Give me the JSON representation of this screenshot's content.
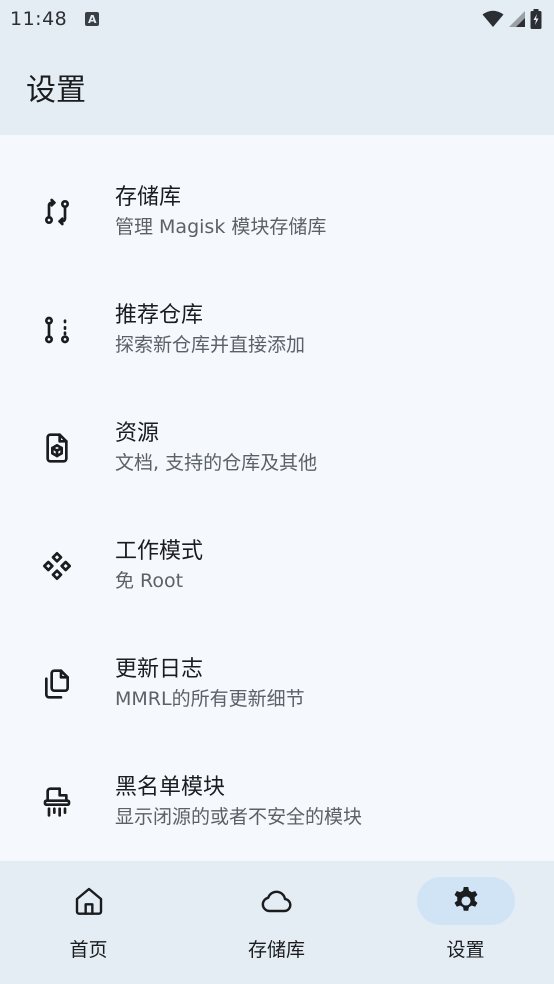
{
  "status_bar": {
    "time": "11:48",
    "notification_icon": "A",
    "icons": [
      "wifi-icon",
      "signal-icon",
      "battery-charging-icon"
    ]
  },
  "header": {
    "title": "设置"
  },
  "settings": [
    {
      "title": "存储库",
      "subtitle": "管理 Magisk 模块存储库",
      "icon": "git-compare-icon"
    },
    {
      "title": "推荐仓库",
      "subtitle": "探索新仓库并直接添加",
      "icon": "git-pull-request-draft-icon"
    },
    {
      "title": "资源",
      "subtitle": "文档, 支持的仓库及其他",
      "icon": "file-box-icon"
    },
    {
      "title": "工作模式",
      "subtitle": "免 Root",
      "icon": "components-icon"
    },
    {
      "title": "更新日志",
      "subtitle": "MMRL的所有更新细节",
      "icon": "files-icon"
    },
    {
      "title": "黑名单模块",
      "subtitle": "显示闭源的或者不安全的模块",
      "icon": "shredder-icon"
    }
  ],
  "bottom_nav": [
    {
      "label": "首页",
      "icon": "home-icon",
      "active": false
    },
    {
      "label": "存储库",
      "icon": "cloud-icon",
      "active": false
    },
    {
      "label": "设置",
      "icon": "gear-icon",
      "active": true
    }
  ],
  "colors": {
    "surface": "#f5f9fd",
    "surface_container": "#e4ecf4",
    "active_indicator": "#d1e4f6",
    "on_surface": "#1a1c1e",
    "on_surface_variant": "#5b6168"
  }
}
